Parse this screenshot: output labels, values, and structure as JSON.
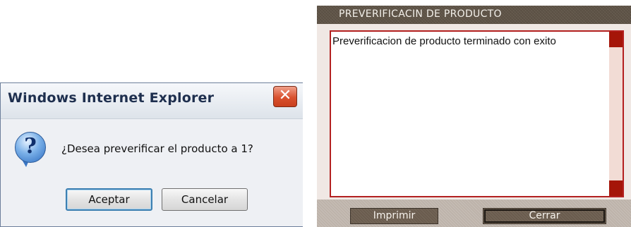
{
  "ie_dialog": {
    "title": "Windows Internet Explorer",
    "close_glyph": "✕",
    "icon": "question-icon",
    "message": "¿Desea preverificar el producto a 1?",
    "ok_label": "Aceptar",
    "cancel_label": "Cancelar"
  },
  "web_dialog": {
    "title": "PREVERIFICACIN DE PRODUCTO",
    "message": "Preverificacion de producto terminado con exito",
    "print_label": "Imprimir",
    "close_label": "Cerrar"
  },
  "colors": {
    "web_titlebar": "#5f5447",
    "web_textarea_border": "#b32020",
    "scroll_button": "#a51509",
    "web_button": "#6a5c4e",
    "ie_close_button": "#d9512e"
  }
}
